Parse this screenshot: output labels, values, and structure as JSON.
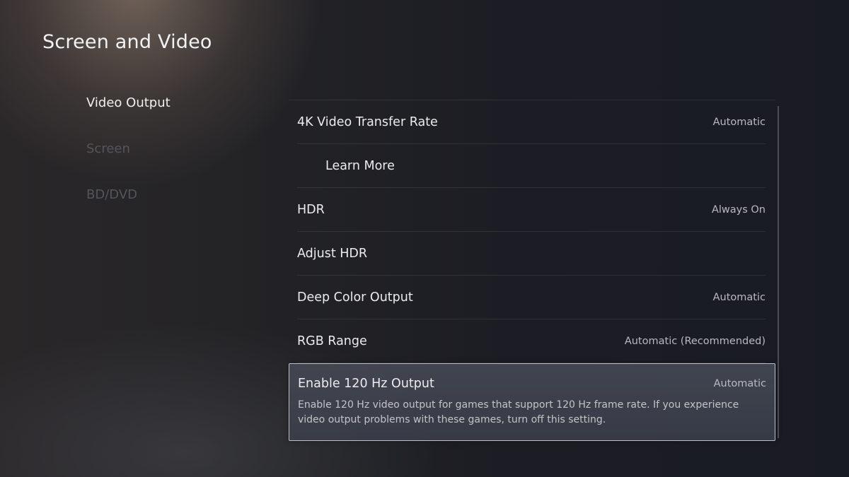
{
  "header": {
    "title": "Screen and Video"
  },
  "sidebar": {
    "items": [
      {
        "label": "Video Output"
      },
      {
        "label": "Screen"
      },
      {
        "label": "BD/DVD"
      }
    ]
  },
  "settings": {
    "rows": [
      {
        "label": "4K Video Transfer Rate",
        "value": "Automatic"
      },
      {
        "label": "Learn More",
        "value": ""
      },
      {
        "label": "HDR",
        "value": "Always On"
      },
      {
        "label": "Adjust HDR",
        "value": ""
      },
      {
        "label": "Deep Color Output",
        "value": "Automatic"
      },
      {
        "label": "RGB Range",
        "value": "Automatic (Recommended)"
      },
      {
        "label": "Enable 120 Hz Output",
        "value": "Automatic",
        "description": "Enable 120 Hz video output for games that support 120 Hz frame rate. If you experience video output problems with these games, turn off this setting."
      }
    ]
  }
}
